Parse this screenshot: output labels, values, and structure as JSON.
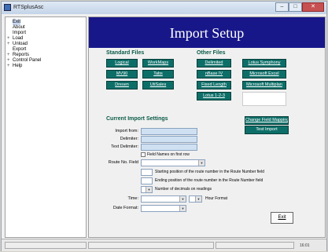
{
  "window": {
    "title": "RTSplusAsc"
  },
  "tree": [
    {
      "label": "Exit",
      "expander": "",
      "level": 1,
      "selected": true
    },
    {
      "label": "About",
      "expander": "",
      "level": 1
    },
    {
      "label": "Import",
      "expander": "",
      "level": 1
    },
    {
      "label": "Load",
      "expander": "+",
      "level": 0
    },
    {
      "label": "Unload",
      "expander": "+",
      "level": 0
    },
    {
      "label": "Export",
      "expander": "",
      "level": 1
    },
    {
      "label": "Reports",
      "expander": "+",
      "level": 0
    },
    {
      "label": "Control Panel",
      "expander": "+",
      "level": 0
    },
    {
      "label": "Help",
      "expander": "+",
      "level": 0
    }
  ],
  "banner": {
    "title": "Import Setup"
  },
  "standard_files": {
    "heading": "Standard Files",
    "buttons": [
      "Logical",
      "WorkMaps",
      "MV90",
      "Tabs",
      "Dresen",
      "UtiSales"
    ]
  },
  "other_files": {
    "heading": "Other Files",
    "buttons": [
      "Delimited",
      "nBase IV",
      "Lotus Symphony",
      "Microsoft Excel",
      "Fixed Length",
      "Microsoft Multiplan",
      "Lotus 1-2-3"
    ]
  },
  "current_settings": {
    "heading": "Current Import Settings",
    "labels": {
      "import_from": "Import from:",
      "delimiter": "Delimiter:",
      "text_delimiter": "Text Delimiter:",
      "field_names": "Field Names on first row",
      "route_no_field": "Route No. Field",
      "starting_position": "Starting position of the route number in the Route Number field",
      "ending_position": "Ending position of the route number in the Route Number field",
      "decimals": "Number of decimals on readings",
      "time": "Time:",
      "hour_format": "Hour Format",
      "date_format": "Date Format:"
    },
    "values": {
      "import_from": "",
      "delimiter": "",
      "text_delimiter": "",
      "route_no_field": "",
      "time": "",
      "date_format": ""
    }
  },
  "actions": {
    "change_field_mapping": "Change Field Mapping",
    "test_import": "Test Import",
    "exit": "Exit"
  },
  "statusbar": {
    "time": "16:01"
  },
  "colors": {
    "banner": "#18178a",
    "button": "#0d6e68",
    "section_heading": "#0a5a46",
    "input": "#cfe0f2"
  }
}
